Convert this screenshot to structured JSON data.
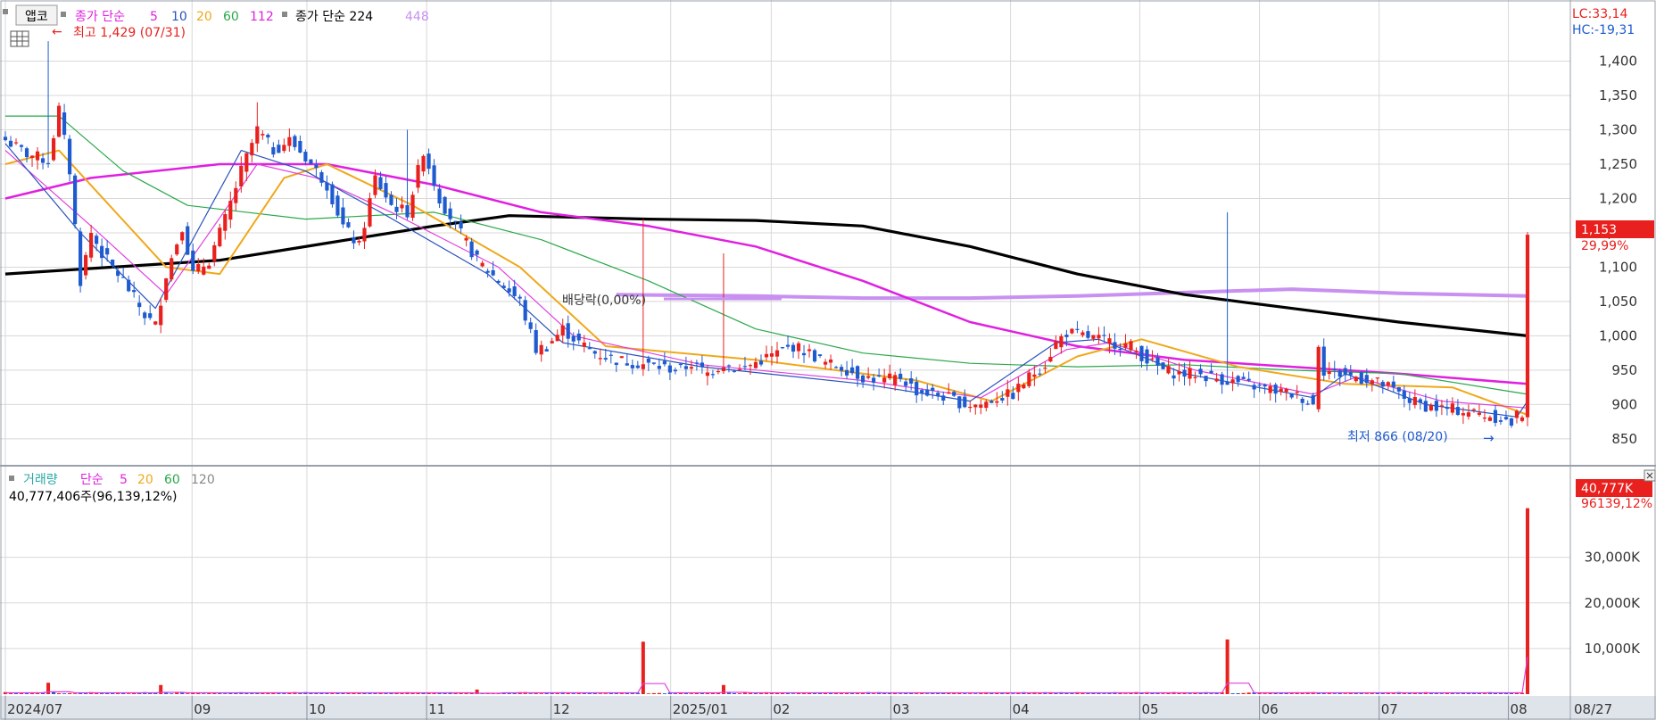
{
  "toolbar": {
    "button_label": "앱코",
    "price_ma_title": "종가 단순",
    "price_ma_periods": [
      "5",
      "10",
      "20",
      "60",
      "112"
    ],
    "price_ma2_title": "종가 단순 224",
    "price_ma2_extra": "448",
    "grid_icon": "grid-icon"
  },
  "annotations": {
    "high": "최고 1,429 (07/31)",
    "low": "최저 866 (08/20)",
    "dividend": "배당락(0,00%)"
  },
  "right_info": {
    "lc": "LC:33,14",
    "hc": "HC:-19,31",
    "last_price": "1,153",
    "last_change": "29,99%",
    "last_volume": "40,777K",
    "volume_ratio": "96139,12%"
  },
  "volume_header": {
    "title": "거래량",
    "ma_title": "단순",
    "ma_periods": [
      "5",
      "20",
      "60",
      "120"
    ],
    "value_text": "40,777,406주(96,139,12%)"
  },
  "colors": {
    "up": "#e8201e",
    "down": "#1f5bd0",
    "ma5": "#2a52be",
    "ma10": "#e040e0",
    "ma20": "#f0a81a",
    "ma60": "#2aa84a",
    "ma112": "#e020e0",
    "ma224": "#000000",
    "ma448": "#c890f0",
    "grid": "#d8d8d8",
    "axis_bg": "#dfe3ea"
  },
  "chart_data": {
    "type": "candlestick",
    "price_axis": {
      "ticks": [
        "1,400",
        "1,350",
        "1,300",
        "1,250",
        "1,200",
        "1,150",
        "1,100",
        "1,050",
        "1,000",
        "950",
        "900",
        "850"
      ],
      "ylim": [
        820,
        1450
      ]
    },
    "volume_axis": {
      "ticks": [
        "30,000K",
        "20,000K",
        "10,000K"
      ],
      "ylim": [
        0,
        45000
      ]
    },
    "x_axis_labels": [
      "2024/07",
      "09",
      "10",
      "11",
      "12",
      "2025/01",
      "02",
      "03",
      "04",
      "05",
      "06",
      "07",
      "08",
      "08/27"
    ],
    "price_keypoints": [
      [
        0,
        1285
      ],
      [
        4,
        1265
      ],
      [
        8,
        1255
      ],
      [
        10,
        1330
      ],
      [
        12,
        1240
      ],
      [
        14,
        1080
      ],
      [
        16,
        1150
      ],
      [
        18,
        1120
      ],
      [
        22,
        1080
      ],
      [
        26,
        1030
      ],
      [
        28,
        1015
      ],
      [
        30,
        1090
      ],
      [
        33,
        1160
      ],
      [
        35,
        1090
      ],
      [
        38,
        1110
      ],
      [
        41,
        1170
      ],
      [
        44,
        1240
      ],
      [
        47,
        1300
      ],
      [
        50,
        1270
      ],
      [
        53,
        1285
      ],
      [
        56,
        1260
      ],
      [
        60,
        1220
      ],
      [
        63,
        1160
      ],
      [
        66,
        1130
      ],
      [
        69,
        1230
      ],
      [
        72,
        1190
      ],
      [
        75,
        1180
      ],
      [
        78,
        1270
      ],
      [
        81,
        1200
      ],
      [
        84,
        1160
      ],
      [
        88,
        1110
      ],
      [
        92,
        1080
      ],
      [
        96,
        1050
      ],
      [
        99,
        980
      ],
      [
        101,
        985
      ],
      [
        104,
        1010
      ],
      [
        107,
        990
      ],
      [
        110,
        975
      ],
      [
        114,
        965
      ],
      [
        118,
        960
      ],
      [
        122,
        955
      ],
      [
        126,
        950
      ],
      [
        128,
        960
      ],
      [
        131,
        945
      ],
      [
        134,
        960
      ],
      [
        137,
        950
      ],
      [
        141,
        965
      ],
      [
        144,
        975
      ],
      [
        147,
        985
      ],
      [
        150,
        975
      ],
      [
        153,
        960
      ],
      [
        156,
        955
      ],
      [
        160,
        940
      ],
      [
        164,
        935
      ],
      [
        167,
        940
      ],
      [
        170,
        920
      ],
      [
        173,
        915
      ],
      [
        176,
        910
      ],
      [
        179,
        900
      ],
      [
        182,
        900
      ],
      [
        185,
        910
      ],
      [
        188,
        915
      ],
      [
        191,
        940
      ],
      [
        194,
        960
      ],
      [
        196,
        990
      ],
      [
        198,
        1005
      ],
      [
        201,
        1000
      ],
      [
        204,
        995
      ],
      [
        207,
        990
      ],
      [
        210,
        985
      ],
      [
        213,
        965
      ],
      [
        216,
        950
      ],
      [
        219,
        945
      ],
      [
        222,
        945
      ],
      [
        225,
        940
      ],
      [
        228,
        935
      ],
      [
        231,
        930
      ],
      [
        234,
        925
      ],
      [
        237,
        920
      ],
      [
        240,
        915
      ],
      [
        242,
        910
      ],
      [
        244,
        900
      ],
      [
        245,
        990
      ],
      [
        246,
        950
      ],
      [
        249,
        945
      ],
      [
        252,
        940
      ],
      [
        255,
        935
      ],
      [
        258,
        925
      ],
      [
        261,
        910
      ],
      [
        264,
        900
      ],
      [
        267,
        895
      ],
      [
        270,
        893
      ],
      [
        273,
        890
      ],
      [
        276,
        885
      ],
      [
        279,
        880
      ],
      [
        281,
        872
      ],
      [
        282,
        884
      ],
      [
        283,
        887
      ],
      [
        284,
        1153
      ]
    ],
    "ma_lines": [
      {
        "period": 5,
        "points": [
          [
            0,
            1280
          ],
          [
            14,
            1150
          ],
          [
            28,
            1040
          ],
          [
            44,
            1270
          ],
          [
            56,
            1240
          ],
          [
            70,
            1180
          ],
          [
            90,
            1090
          ],
          [
            104,
            990
          ],
          [
            130,
            955
          ],
          [
            160,
            930
          ],
          [
            180,
            905
          ],
          [
            196,
            990
          ],
          [
            204,
            995
          ],
          [
            220,
            945
          ],
          [
            244,
            910
          ],
          [
            250,
            945
          ],
          [
            265,
            900
          ],
          [
            282,
            882
          ],
          [
            284,
            905
          ]
        ]
      },
      {
        "period": 10,
        "points": [
          [
            0,
            1270
          ],
          [
            16,
            1160
          ],
          [
            30,
            1060
          ],
          [
            47,
            1250
          ],
          [
            58,
            1230
          ],
          [
            72,
            1180
          ],
          [
            92,
            1100
          ],
          [
            106,
            1000
          ],
          [
            130,
            958
          ],
          [
            160,
            935
          ],
          [
            182,
            910
          ],
          [
            198,
            980
          ],
          [
            206,
            990
          ],
          [
            222,
            950
          ],
          [
            244,
            915
          ],
          [
            252,
            940
          ],
          [
            268,
            905
          ],
          [
            284,
            895
          ]
        ]
      },
      {
        "period": 20,
        "points": [
          [
            0,
            1250
          ],
          [
            10,
            1270
          ],
          [
            30,
            1100
          ],
          [
            40,
            1090
          ],
          [
            52,
            1230
          ],
          [
            60,
            1250
          ],
          [
            76,
            1190
          ],
          [
            96,
            1100
          ],
          [
            112,
            985
          ],
          [
            140,
            965
          ],
          [
            170,
            935
          ],
          [
            184,
            905
          ],
          [
            200,
            970
          ],
          [
            212,
            995
          ],
          [
            230,
            955
          ],
          [
            250,
            930
          ],
          [
            270,
            925
          ],
          [
            284,
            885
          ]
        ]
      },
      {
        "period": 60,
        "points": [
          [
            0,
            1320
          ],
          [
            10,
            1320
          ],
          [
            22,
            1240
          ],
          [
            34,
            1190
          ],
          [
            56,
            1170
          ],
          [
            80,
            1180
          ],
          [
            100,
            1140
          ],
          [
            120,
            1080
          ],
          [
            140,
            1010
          ],
          [
            160,
            975
          ],
          [
            180,
            960
          ],
          [
            200,
            955
          ],
          [
            220,
            958
          ],
          [
            240,
            950
          ],
          [
            260,
            945
          ],
          [
            284,
            915
          ]
        ]
      },
      {
        "period": 112,
        "points": [
          [
            0,
            1200
          ],
          [
            16,
            1230
          ],
          [
            40,
            1250
          ],
          [
            60,
            1250
          ],
          [
            80,
            1220
          ],
          [
            100,
            1180
          ],
          [
            120,
            1160
          ],
          [
            140,
            1130
          ],
          [
            160,
            1080
          ],
          [
            180,
            1020
          ],
          [
            200,
            985
          ],
          [
            220,
            965
          ],
          [
            240,
            955
          ],
          [
            260,
            945
          ],
          [
            284,
            930
          ]
        ]
      },
      {
        "period": 224,
        "points": [
          [
            0,
            1090
          ],
          [
            20,
            1100
          ],
          [
            40,
            1110
          ],
          [
            60,
            1135
          ],
          [
            80,
            1160
          ],
          [
            94,
            1175
          ],
          [
            120,
            1170
          ],
          [
            140,
            1168
          ],
          [
            160,
            1160
          ],
          [
            180,
            1130
          ],
          [
            200,
            1090
          ],
          [
            220,
            1060
          ],
          [
            240,
            1040
          ],
          [
            260,
            1020
          ],
          [
            284,
            1000
          ]
        ]
      },
      {
        "period": 448,
        "points": [
          [
            114,
            1060
          ],
          [
            140,
            1058
          ],
          [
            160,
            1055
          ],
          [
            180,
            1055
          ],
          [
            200,
            1058
          ],
          [
            220,
            1063
          ],
          [
            240,
            1068
          ],
          [
            260,
            1062
          ],
          [
            284,
            1058
          ]
        ]
      }
    ],
    "volume_spikes": [
      {
        "index": 8,
        "value": 2500
      },
      {
        "index": 29,
        "value": 2000
      },
      {
        "index": 88,
        "value": 1000
      },
      {
        "index": 119,
        "value": 11500
      },
      {
        "index": 134,
        "value": 2000
      },
      {
        "index": 228,
        "value": 12000
      },
      {
        "index": 284,
        "value": 40777
      }
    ]
  }
}
